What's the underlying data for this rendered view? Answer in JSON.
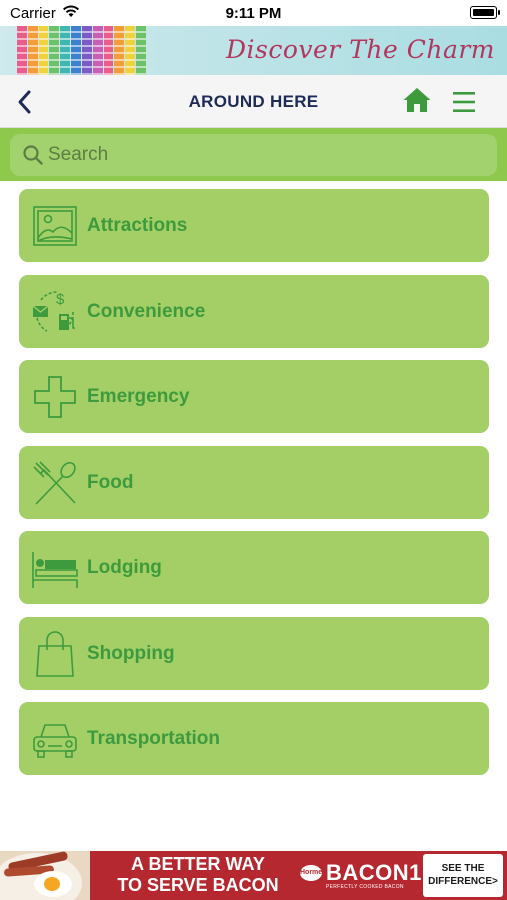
{
  "status_bar": {
    "carrier": "Carrier",
    "time": "9:11 PM"
  },
  "banner": {
    "brand_text": "Discover The Charm",
    "stripe_colors": [
      "#e85d8c",
      "#f39c3a",
      "#f2d23c",
      "#6cc26a",
      "#3fb6b0",
      "#3e7fd1",
      "#7b5cc4",
      "#c85fb5",
      "#e85d8c",
      "#f39c3a",
      "#f2d23c",
      "#6cc26a"
    ]
  },
  "header": {
    "title": "AROUND HERE",
    "back_icon": "chevron-left-icon",
    "home_icon": "home-icon",
    "menu_icon": "hamburger-menu-icon"
  },
  "search": {
    "placeholder": "Search",
    "value": ""
  },
  "categories": [
    {
      "label": "Attractions",
      "icon": "landscape-picture-icon"
    },
    {
      "label": "Convenience",
      "icon": "mail-dollar-fuel-icon"
    },
    {
      "label": "Emergency",
      "icon": "medical-cross-icon"
    },
    {
      "label": "Food",
      "icon": "fork-spoon-icon"
    },
    {
      "label": "Lodging",
      "icon": "bed-icon"
    },
    {
      "label": "Shopping",
      "icon": "shopping-bag-icon"
    },
    {
      "label": "Transportation",
      "icon": "car-icon"
    }
  ],
  "ad": {
    "headline_line1": "A BETTER WAY",
    "headline_line2": "TO SERVE BACON",
    "brand_badge": "Hormel",
    "product_name": "BACON1",
    "product_tagline": "PERFECTLY COOKED BACON",
    "cta_line1": "SEE THE",
    "cta_line2": "DIFFERENCE>"
  },
  "colors": {
    "accent_green": "#8ec94e",
    "tile_green": "#a3cf66",
    "label_green": "#3e9b3d",
    "title_navy": "#1f2b57",
    "ad_red": "#b5282f"
  }
}
